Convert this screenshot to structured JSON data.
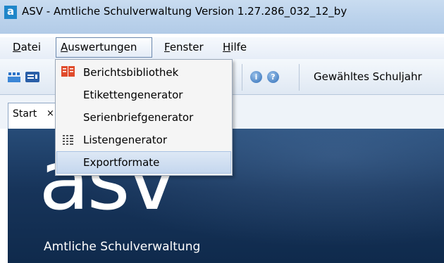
{
  "window": {
    "title": "ASV - Amtliche Schulverwaltung Version 1.27.286_032_12_by",
    "app_icon_letter": "a"
  },
  "menubar": {
    "items": [
      {
        "label": "Datei",
        "mnemonic": "D"
      },
      {
        "label": "Auswertungen",
        "mnemonic": "A"
      },
      {
        "label": "Fenster",
        "mnemonic": "F"
      },
      {
        "label": "Hilfe",
        "mnemonic": "H"
      }
    ]
  },
  "toolbar": {
    "schuljahr_label": "Gewähltes Schuljahr",
    "info_icon_glyph": "i",
    "help_icon_glyph": "?"
  },
  "dropdown": {
    "items": [
      {
        "label": "Berichtsbibliothek",
        "icon": "book-icon"
      },
      {
        "label": "Etikettengenerator",
        "icon": null
      },
      {
        "label": "Serienbriefgenerator",
        "icon": null
      },
      {
        "label": "Listengenerator",
        "icon": "list-icon"
      },
      {
        "label": "Exportformate",
        "icon": null,
        "highlighted": true
      }
    ]
  },
  "tabs": [
    {
      "label": "Start",
      "close": "×"
    }
  ],
  "start_page": {
    "logo_text": "asv",
    "subtitle": "Amtliche Schulverwaltung"
  },
  "colors": {
    "accent": "#1f86c9",
    "content_background": "#17345a",
    "menu_highlight": "#c5d7ee"
  }
}
